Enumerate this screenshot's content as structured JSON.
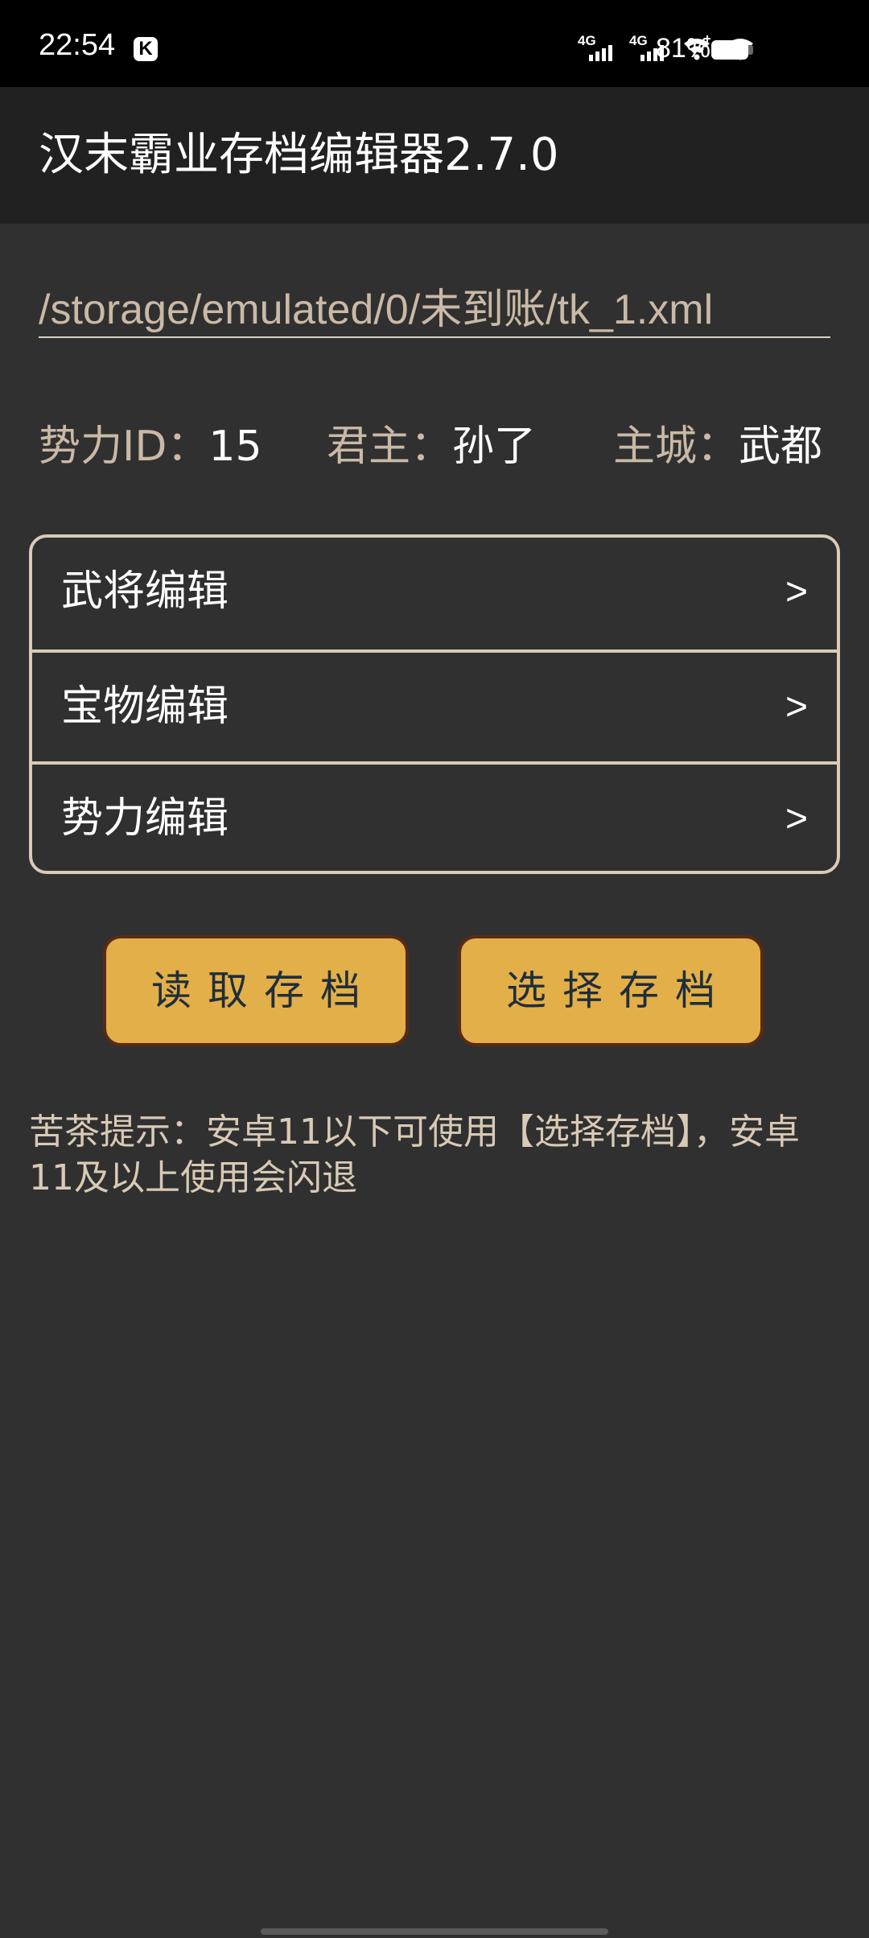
{
  "status_bar": {
    "time": "22:54",
    "notification_icon": "K",
    "network_1": "4G",
    "network_2": "4G",
    "battery_percent": "81%"
  },
  "app_bar": {
    "title": "汉末霸业存档编辑器2.7.0"
  },
  "path_field": {
    "value": "/storage/emulated/0/未到账/tk_1.xml"
  },
  "info": {
    "faction_id_label": "势力ID：",
    "faction_id_value": "15",
    "lord_label": "君主：",
    "lord_value": "孙了",
    "capital_label": "主城：",
    "capital_value": "武都"
  },
  "menu": {
    "items": [
      {
        "label": "武将编辑",
        "arrow": ">"
      },
      {
        "label": "宝物编辑",
        "arrow": ">"
      },
      {
        "label": "势力编辑",
        "arrow": ">"
      }
    ]
  },
  "buttons": {
    "read_save": "读取存档",
    "select_save": "选择存档"
  },
  "tip": {
    "text": "苦茶提示：安卓11以下可使用【选择存档】，安卓11及以上使用会闪退"
  },
  "colors": {
    "background": "#303030",
    "app_bar": "#212121",
    "button_fill": "#e3af48",
    "button_border": "#5a2a14",
    "label_tan": "#c9b9a6"
  }
}
